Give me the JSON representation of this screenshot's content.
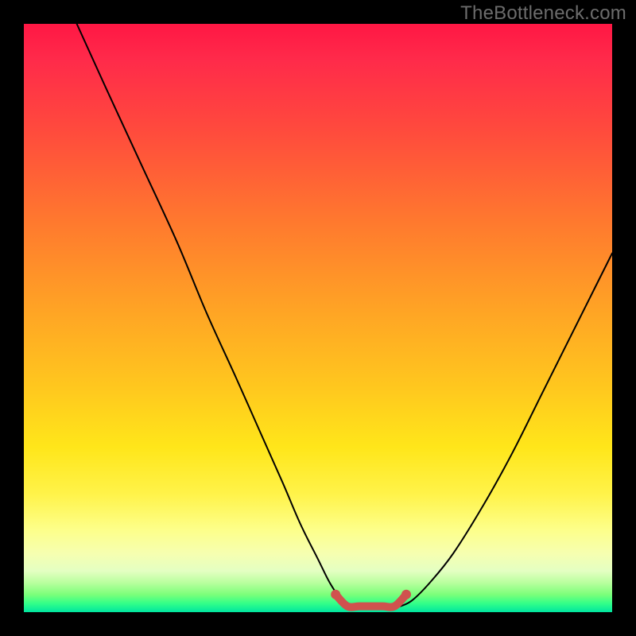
{
  "watermark": "TheBottleneck.com",
  "colors": {
    "frame_bg": "#000000",
    "watermark_text": "#6c6c6c",
    "curve_black": "#000000",
    "valley_red": "#d0524e",
    "gradient": [
      "#ff1744",
      "#ff7a2e",
      "#ffe61a",
      "#f6ffb0",
      "#00e5a0"
    ]
  },
  "chart_data": {
    "type": "line",
    "title": "",
    "xlabel": "",
    "ylabel": "",
    "xlim": [
      0,
      100
    ],
    "ylim": [
      0,
      100
    ],
    "series": [
      {
        "name": "left-descending-curve",
        "x": [
          9,
          14,
          20,
          26,
          31,
          36,
          40,
          44,
          47,
          50,
          52,
          54,
          55
        ],
        "values": [
          100,
          89,
          76,
          63,
          51,
          40,
          31,
          22,
          15,
          9,
          5,
          2,
          1
        ]
      },
      {
        "name": "right-ascending-curve",
        "x": [
          64,
          66,
          69,
          73,
          78,
          83,
          88,
          93,
          97,
          100
        ],
        "values": [
          1,
          2,
          5,
          10,
          18,
          27,
          37,
          47,
          55,
          61
        ]
      },
      {
        "name": "valley-flat-highlight",
        "x": [
          53,
          55,
          57,
          59,
          61,
          63,
          65
        ],
        "values": [
          3,
          1,
          1,
          1,
          1,
          1,
          3
        ]
      }
    ],
    "annotations": []
  }
}
